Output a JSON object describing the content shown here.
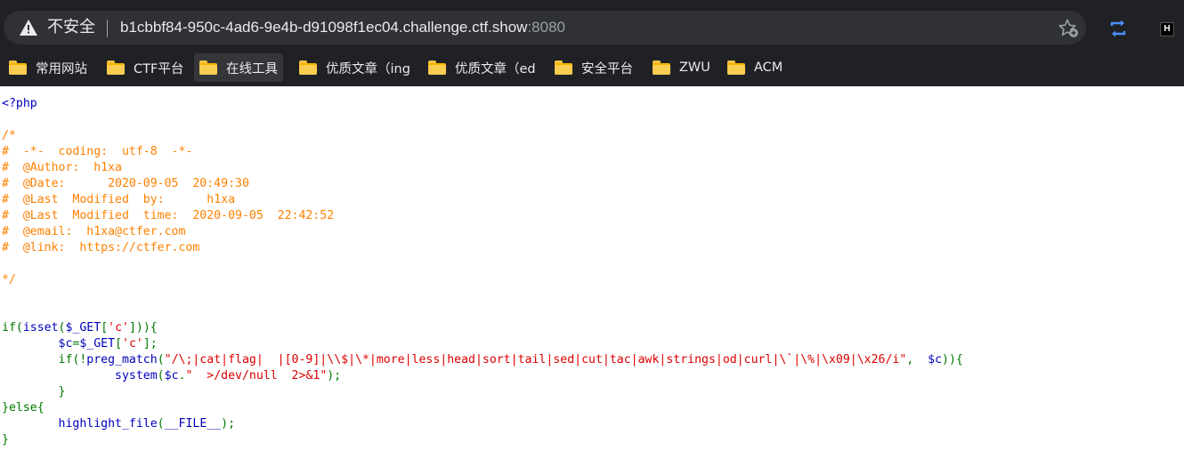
{
  "address_bar": {
    "security_label": "不安全",
    "url_host": "b1cbbf84-950c-4ad6-9e4b-d91098f1ec04.challenge.ctf.show",
    "url_port": ":8080"
  },
  "toolbar": {
    "star_icon": "bookmark-star-icon",
    "sync_icon": "sync-icon",
    "extension_label": "H"
  },
  "bookmarks": [
    {
      "label": "常用网站"
    },
    {
      "label": "CTF平台"
    },
    {
      "label": "在线工具"
    },
    {
      "label": "优质文章（ing"
    },
    {
      "label": "优质文章（ed"
    },
    {
      "label": "安全平台"
    },
    {
      "label": "ZWU"
    },
    {
      "label": "ACM"
    }
  ],
  "colors": {
    "default": "#0000BB",
    "comment": "#FF8000",
    "keyword": "#007700",
    "string": "#DD0000"
  },
  "code_lines": [
    [
      [
        "default",
        "<?php"
      ]
    ],
    [],
    [
      [
        "comment",
        "/*"
      ]
    ],
    [
      [
        "comment",
        "#  -*-  coding:  utf-8  -*-"
      ]
    ],
    [
      [
        "comment",
        "#  @Author:  h1xa"
      ]
    ],
    [
      [
        "comment",
        "#  @Date:      2020-09-05  20:49:30"
      ]
    ],
    [
      [
        "comment",
        "#  @Last  Modified  by:      h1xa"
      ]
    ],
    [
      [
        "comment",
        "#  @Last  Modified  time:  2020-09-05  22:42:52"
      ]
    ],
    [
      [
        "comment",
        "#  @email:  h1xa@ctfer.com"
      ]
    ],
    [
      [
        "comment",
        "#  @link:  https://ctfer.com"
      ]
    ],
    [],
    [
      [
        "comment",
        "*/"
      ]
    ],
    [],
    [],
    [
      [
        "keyword",
        "if("
      ],
      [
        "default",
        "isset"
      ],
      [
        "keyword",
        "("
      ],
      [
        "default",
        "$_GET"
      ],
      [
        "keyword",
        "["
      ],
      [
        "string",
        "'c'"
      ],
      [
        "keyword",
        "])){"
      ]
    ],
    [
      [
        "default",
        "        $c"
      ],
      [
        "keyword",
        "="
      ],
      [
        "default",
        "$_GET"
      ],
      [
        "keyword",
        "["
      ],
      [
        "string",
        "'c'"
      ],
      [
        "keyword",
        "];"
      ]
    ],
    [
      [
        "keyword",
        "        if(!"
      ],
      [
        "default",
        "preg_match"
      ],
      [
        "keyword",
        "("
      ],
      [
        "string",
        "\"/\\;|cat|flag|  |[0-9]|\\\\$|\\*|more|less|head|sort|tail|sed|cut|tac|awk|strings|od|curl|\\`|\\%|\\x09|\\x26/i\""
      ],
      [
        "keyword",
        ",  "
      ],
      [
        "default",
        "$c"
      ],
      [
        "keyword",
        ")){"
      ]
    ],
    [
      [
        "default",
        "                system"
      ],
      [
        "keyword",
        "("
      ],
      [
        "default",
        "$c"
      ],
      [
        "keyword",
        "."
      ],
      [
        "string",
        "\"  >/dev/null  2>&1\""
      ],
      [
        "keyword",
        ");"
      ]
    ],
    [
      [
        "keyword",
        "        }"
      ]
    ],
    [
      [
        "keyword",
        "}else{"
      ]
    ],
    [
      [
        "default",
        "        highlight_file"
      ],
      [
        "keyword",
        "("
      ],
      [
        "default",
        "__FILE__"
      ],
      [
        "keyword",
        ");"
      ]
    ],
    [
      [
        "keyword",
        "}"
      ]
    ]
  ]
}
